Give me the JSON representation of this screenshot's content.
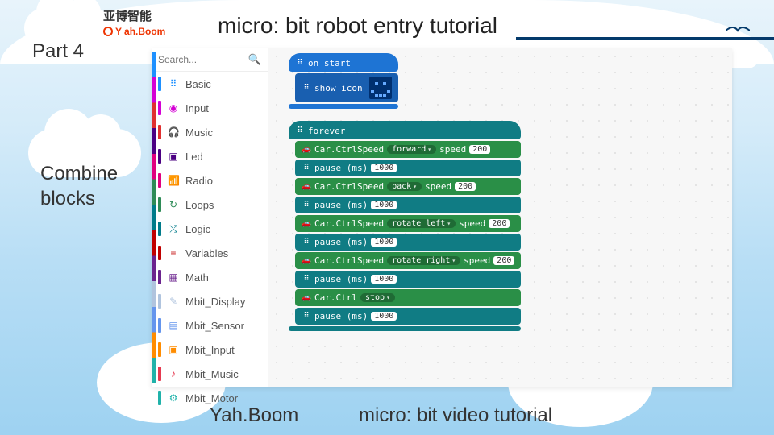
{
  "header": {
    "title": "micro: bit robot entry tutorial",
    "logo_top": "亚博智能",
    "logo_bottom": "ah.Boom",
    "part": "Part 4",
    "section": "Combine\nblocks"
  },
  "footer": {
    "brand": "Yah.Boom",
    "text": "micro: bit video tutorial"
  },
  "sidebar": {
    "search_placeholder": "Search...",
    "items": [
      {
        "label": "Basic",
        "color": "#1e90ff",
        "icon": "⠿"
      },
      {
        "label": "Input",
        "color": "#d400d4",
        "icon": "◉"
      },
      {
        "label": "Music",
        "color": "#e03030",
        "icon": "🎧"
      },
      {
        "label": "Led",
        "color": "#4b0082",
        "icon": "▣"
      },
      {
        "label": "Radio",
        "color": "#e0007f",
        "icon": "📶"
      },
      {
        "label": "Loops",
        "color": "#2e8b57",
        "icon": "↻"
      },
      {
        "label": "Logic",
        "color": "#007b8a",
        "icon": "⤭"
      },
      {
        "label": "Variables",
        "color": "#c00000",
        "icon": "≡"
      },
      {
        "label": "Math",
        "color": "#6b238e",
        "icon": "▦"
      },
      {
        "label": "Mbit_Display",
        "color": "#b0c4de",
        "icon": "✎"
      },
      {
        "label": "Mbit_Sensor",
        "color": "#6495ed",
        "icon": "▤"
      },
      {
        "label": "Mbit_Input",
        "color": "#ff8c00",
        "icon": "▣"
      },
      {
        "label": "Mbit_Music",
        "color": "#e63950",
        "icon": "♪"
      },
      {
        "label": "Mbit_Motor",
        "color": "#20b2aa",
        "icon": "⚙"
      }
    ]
  },
  "blocks": {
    "onstart": {
      "hat": "on start",
      "show_icon": "show icon"
    },
    "forever": {
      "hat": "forever",
      "rows": [
        {
          "type": "car",
          "label": "Car.CtrlSpeed",
          "dir": "forward",
          "speed_label": "speed",
          "speed": "200"
        },
        {
          "type": "pause",
          "label": "pause (ms)",
          "val": "1000"
        },
        {
          "type": "car",
          "label": "Car.CtrlSpeed",
          "dir": "back",
          "speed_label": "speed",
          "speed": "200"
        },
        {
          "type": "pause",
          "label": "pause (ms)",
          "val": "1000"
        },
        {
          "type": "car",
          "label": "Car.CtrlSpeed",
          "dir": "rotate left",
          "speed_label": "speed",
          "speed": "200"
        },
        {
          "type": "pause",
          "label": "pause (ms)",
          "val": "1000"
        },
        {
          "type": "car",
          "label": "Car.CtrlSpeed",
          "dir": "rotate right",
          "speed_label": "speed",
          "speed": "200"
        },
        {
          "type": "pause",
          "label": "pause (ms)",
          "val": "1000"
        },
        {
          "type": "carstop",
          "label": "Car.Ctrl",
          "dir": "stop"
        },
        {
          "type": "pause",
          "label": "pause (ms)",
          "val": "1000"
        }
      ]
    }
  }
}
